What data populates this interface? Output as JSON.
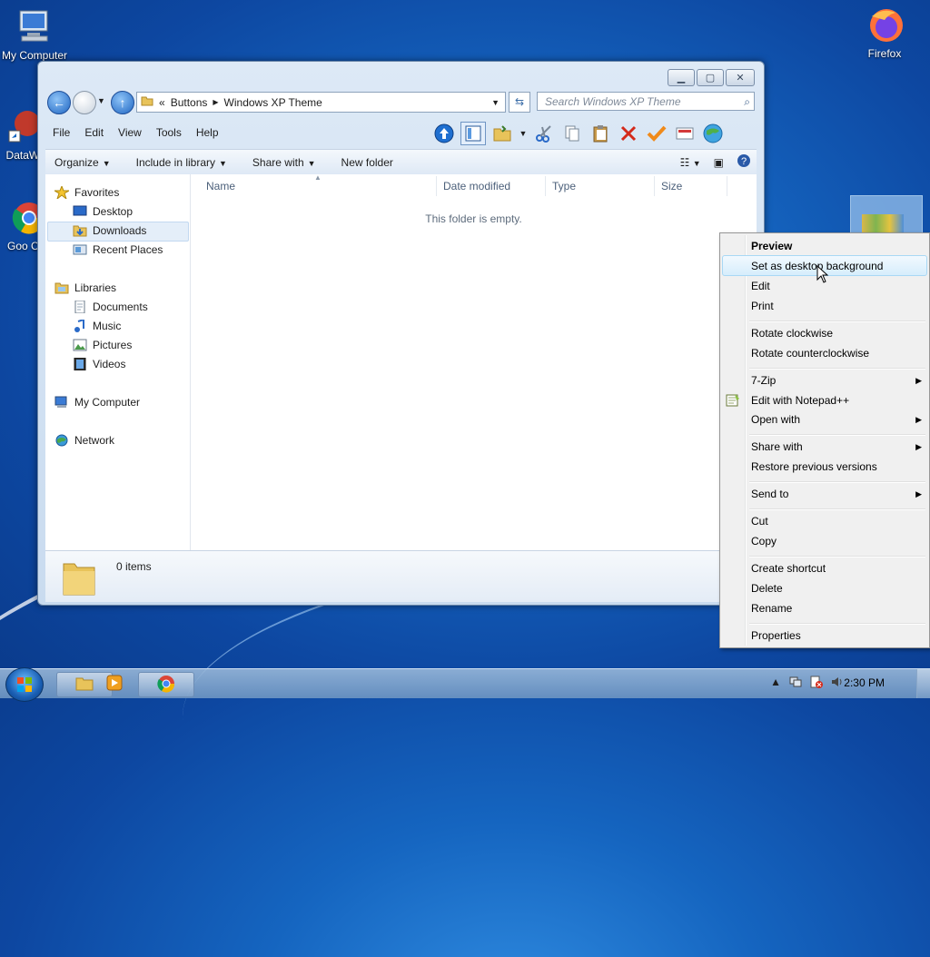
{
  "desktop": {
    "icons": [
      {
        "label": "My Computer"
      },
      {
        "label": "DataWa"
      },
      {
        "label": "Goo Chro"
      },
      {
        "label": "Firefox"
      }
    ]
  },
  "window": {
    "address": {
      "overflow": "«",
      "crumbs": [
        "Buttons",
        "Windows XP Theme"
      ]
    },
    "search_placeholder": "Search Windows XP Theme",
    "menu": [
      "File",
      "Edit",
      "View",
      "Tools",
      "Help"
    ],
    "commands": [
      "Organize",
      "Include in library",
      "Share with",
      "New folder"
    ],
    "nav": {
      "favorites": "Favorites",
      "favorites_items": [
        "Desktop",
        "Downloads",
        "Recent Places"
      ],
      "libraries": "Libraries",
      "libraries_items": [
        "Documents",
        "Music",
        "Pictures",
        "Videos"
      ],
      "computer": "My Computer",
      "network": "Network"
    },
    "columns": [
      "Name",
      "Date modified",
      "Type",
      "Size"
    ],
    "empty_text": "This folder is empty.",
    "item_count": "0 items"
  },
  "context_menu": {
    "items": [
      {
        "label": "Preview",
        "bold": true
      },
      {
        "label": "Set as desktop background"
      },
      {
        "label": "Edit"
      },
      {
        "label": "Print"
      },
      {
        "label": "Rotate clockwise"
      },
      {
        "label": "Rotate counterclockwise"
      },
      {
        "label": "7-Zip"
      },
      {
        "label": "Edit with Notepad++"
      },
      {
        "label": "Open with"
      },
      {
        "label": "Share with"
      },
      {
        "label": "Restore previous versions"
      },
      {
        "label": "Send to"
      },
      {
        "label": "Cut"
      },
      {
        "label": "Copy"
      },
      {
        "label": "Create shortcut"
      },
      {
        "label": "Delete"
      },
      {
        "label": "Rename"
      },
      {
        "label": "Properties"
      }
    ]
  },
  "taskbar": {
    "clock": "2:30 PM"
  }
}
